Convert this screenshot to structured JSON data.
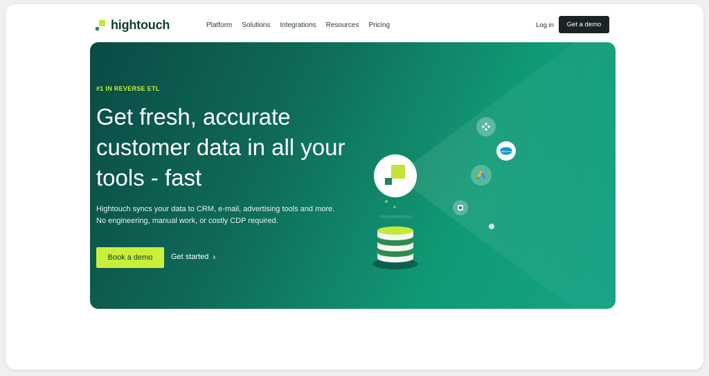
{
  "nav": {
    "brand": "hightouch",
    "menu": [
      "Platform",
      "Solutions",
      "Integrations",
      "Resources",
      "Pricing"
    ],
    "login": "Log in",
    "demo": "Get a demo"
  },
  "hero": {
    "eyebrow": "#1 IN REVERSE ETL",
    "headline": "Get fresh, accurate customer data in all your tools - fast",
    "sub": "Hightouch syncs your data to CRM, e-mail, advertising tools and more. No engineering, manual work, or costly CDP required.",
    "primary_cta": "Book a demo",
    "secondary_cta": "Get started"
  },
  "illustration": {
    "icons": [
      "hightouch-logo-icon",
      "integration-icon",
      "salesforce-icon",
      "google-ads-icon",
      "app-icon"
    ],
    "salesforce_label": "salesforce"
  },
  "colors": {
    "accent": "#c9ef3a",
    "brand_dark": "#0f3d2e",
    "hero_start": "#0a4a45",
    "hero_end": "#16a284",
    "button_dark": "#1b2424"
  }
}
